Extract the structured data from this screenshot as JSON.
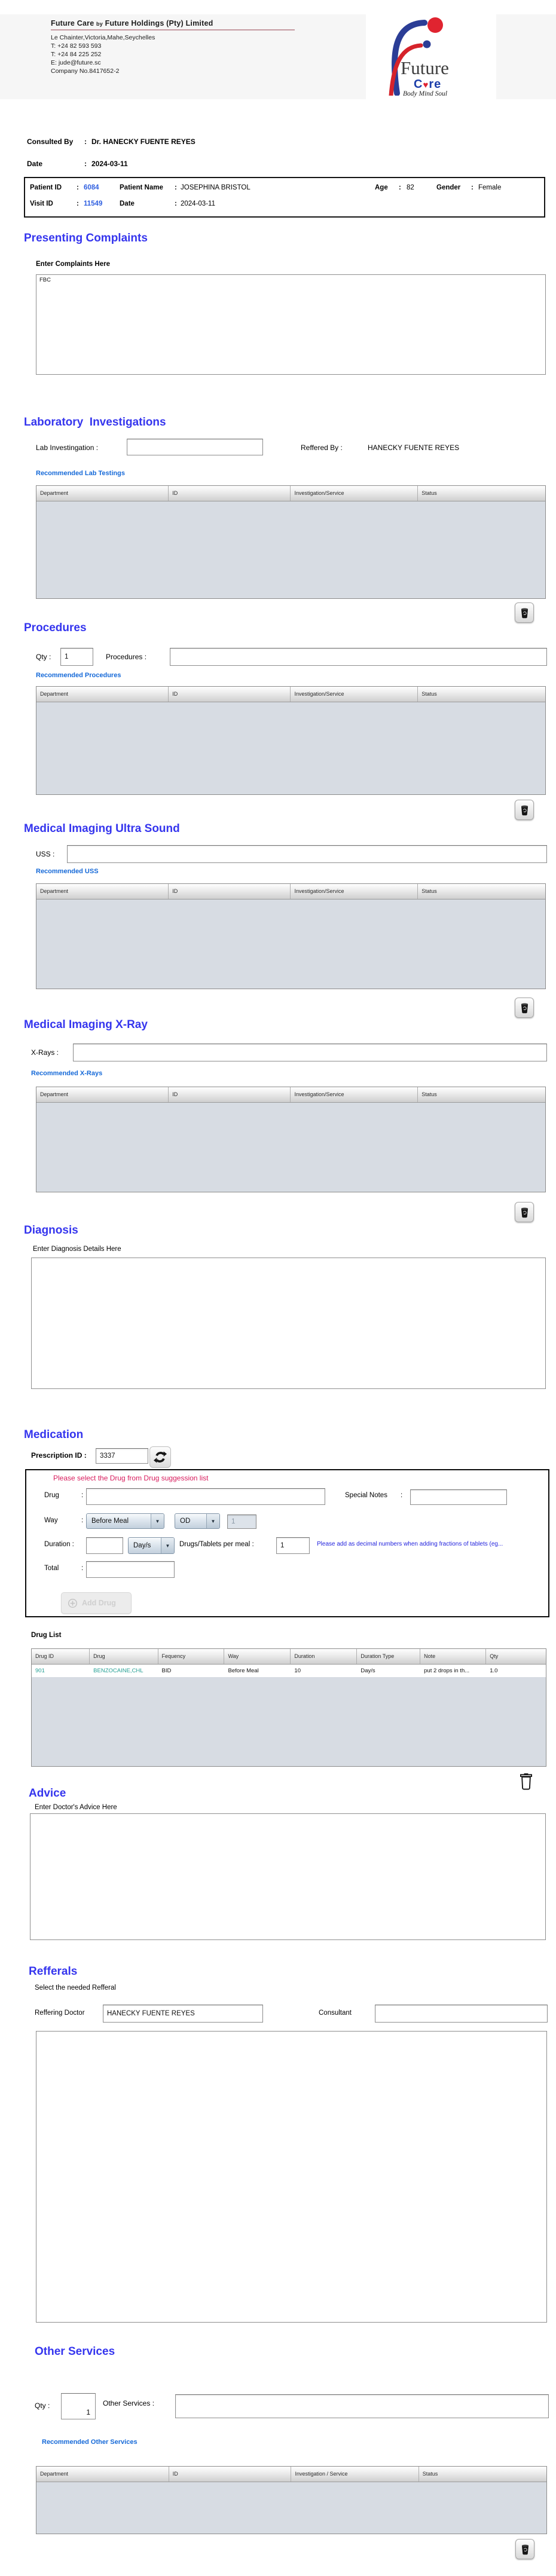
{
  "colors": {
    "accent_blue": "#3535ee",
    "link_blue": "#1569d8",
    "value_blue": "#2f5fe0",
    "warning_red": "#d81b5c",
    "note_blue": "#2222dd",
    "teal": "#26a095",
    "table_body": "#d7dce3"
  },
  "punct": {
    "colon": ":"
  },
  "header": {
    "name_part1": "Future Care",
    "name_by": "by",
    "name_part2": "Future Holdings (Pty) Limited",
    "address": "Le Chainter,Victoria,Mahe,Seychelles",
    "phone1": "T: +24  82 593 593",
    "phone2": "T: +24  84 225 252",
    "email": "E: jude@future.sc",
    "company_no": "Company No.8417652-2",
    "logo": {
      "word1": "Future",
      "word2_pre": "C",
      "heart": "♥",
      "word2_post": "re",
      "tagline": "Body Mind Soul"
    }
  },
  "consultation": {
    "consulted_by_label": "Consulted By",
    "consulted_by_value": "Dr.  HANECKY FUENTE REYES",
    "date_label": "Date",
    "date_value": "2024-03-11"
  },
  "patient": {
    "patient_id_label": "Patient ID",
    "patient_id": "6084",
    "patient_name_label": "Patient Name",
    "patient_name": "JOSEPHINA BRISTOL",
    "age_label": "Age",
    "age": "82",
    "gender_label": "Gender",
    "gender": "Female",
    "visit_id_label": "Visit ID",
    "visit_id": "11549",
    "date_label": "Date",
    "date": "2024-03-11"
  },
  "presenting_complaints": {
    "title": "Presenting Complaints",
    "label": "Enter Complaints Here",
    "value": "FBC"
  },
  "laboratory": {
    "title": "Laboratory  Investigations",
    "lab_label": "Lab Investingation :",
    "lab_value": "",
    "reffered_label": "Reffered By :",
    "reffered_value": "HANECKY FUENTE REYES",
    "recommended_label": "Recommended Lab Testings",
    "table": {
      "headers": [
        "Department",
        "ID",
        "Investigation/Service",
        "Status"
      ],
      "col_widths": [
        "26%",
        "24%",
        "25%",
        "25%"
      ],
      "rows": []
    }
  },
  "procedures": {
    "title": "Procedures",
    "qty_label": "Qty :",
    "qty_value": "1",
    "label": "Procedures :",
    "value": "",
    "recommended_label": "Recommended Procedures",
    "table": {
      "headers": [
        "Department",
        "ID",
        "Investigation/Service",
        "Status"
      ],
      "col_widths": [
        "26%",
        "24%",
        "25%",
        "25%"
      ],
      "rows": []
    }
  },
  "ultrasound": {
    "title": "Medical Imaging Ultra Sound",
    "label": "USS :",
    "value": "",
    "recommended_label": "Recommended USS",
    "table": {
      "headers": [
        "Department",
        "ID",
        "Investigation/Service",
        "Status"
      ],
      "col_widths": [
        "26%",
        "24%",
        "25%",
        "25%"
      ],
      "rows": []
    }
  },
  "xray": {
    "title": "Medical Imaging X-Ray",
    "label": "X-Rays :",
    "value": "",
    "recommended_label": "Recommended X-Rays",
    "table": {
      "headers": [
        "Department",
        "ID",
        "Investigation/Service",
        "Status"
      ],
      "col_widths": [
        "26%",
        "24%",
        "25%",
        "25%"
      ],
      "rows": []
    }
  },
  "diagnosis": {
    "title": "Diagnosis",
    "label": "Enter Diagnosis Details Here",
    "value": ""
  },
  "medication": {
    "title": "Medication",
    "prescription_label": "Prescription ID :",
    "prescription_id": "3337",
    "form": {
      "warning": "Please select the Drug from Drug suggession list",
      "drug_label": "Drug",
      "drug_value": "",
      "special_notes_label": "Special Notes",
      "special_notes_value": "",
      "way_label": "Way",
      "meal_option": "Before Meal",
      "frequency_option": "OD",
      "way_qty": "1",
      "duration_label": "Duration :",
      "duration_value": "",
      "duration_unit": "Day/s",
      "per_meal_label": "Drugs/Tablets per meal :",
      "per_meal_value": "1",
      "fraction_note": "Please add as decimal numbers when adding fractions of tablets (eg...",
      "total_label": "Total",
      "total_value": "",
      "add_button": "Add Drug"
    },
    "drug_list_label": "Drug List",
    "table": {
      "headers": [
        "Drug ID",
        "Drug",
        "Fequency",
        "Way",
        "Duration",
        "Duration Type",
        "Note",
        "Qty"
      ],
      "col_widths": [
        "11.3%",
        "13.3%",
        "12.9%",
        "12.9%",
        "12.9%",
        "12.3%",
        "12.8%",
        "11.6%"
      ],
      "teal_cols": [
        0,
        1
      ],
      "rows": [
        [
          "901",
          "BENZOCAINE,CHL",
          "BID",
          "Before Meal",
          "10",
          "Day/s",
          "put 2 drops in th...",
          "1.0"
        ]
      ]
    }
  },
  "advice": {
    "title": "Advice",
    "label": "Enter Doctor's Advice Here",
    "value": ""
  },
  "refferals": {
    "title": "Refferals",
    "label": "Select the needed Refferal",
    "doctor_label": "Reffering Doctor",
    "doctor_value": "HANECKY FUENTE REYES",
    "consultant_label": "Consultant",
    "consultant_value": ""
  },
  "other_services": {
    "title": "Other Services",
    "qty_label": "Qty :",
    "qty_value": "1",
    "label": "Other Services :",
    "value": "",
    "recommended_label": "Recommended Other Services",
    "table": {
      "headers": [
        "Department",
        "ID",
        "Investigation / Service",
        "Status"
      ],
      "col_widths": [
        "26%",
        "24%",
        "25%",
        "25%"
      ],
      "rows": []
    }
  }
}
